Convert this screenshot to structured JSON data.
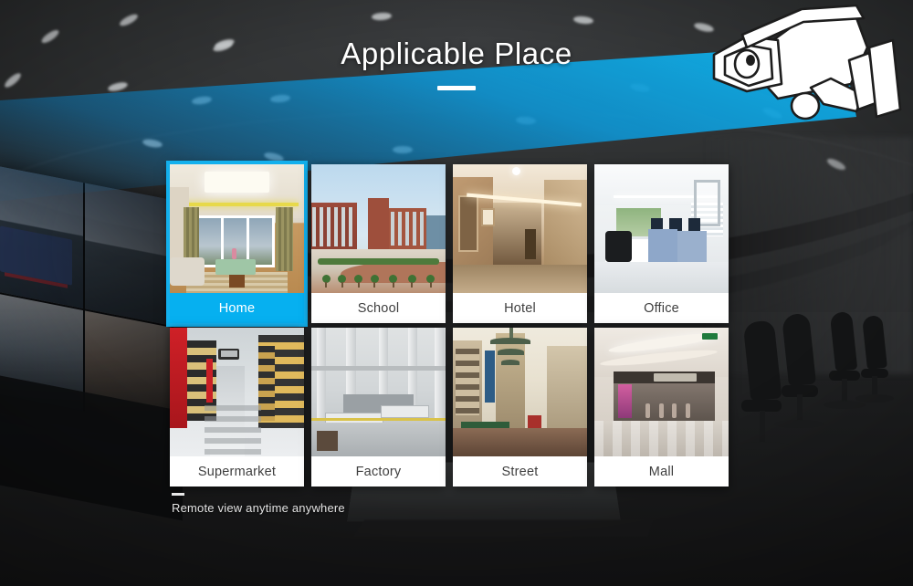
{
  "header": {
    "title": "Applicable Place"
  },
  "camera": {
    "icon": "cctv-camera-icon",
    "beam_color": "#0aa8e0"
  },
  "colors": {
    "accent": "#06b0f0",
    "card_bg": "#ffffff",
    "label_text": "#3f3f3f",
    "active_label_text": "#ffffff",
    "page_bg": "#222324"
  },
  "places": [
    {
      "id": "home",
      "label": "Home",
      "active": true,
      "scene": "living-room-thumbnail"
    },
    {
      "id": "school",
      "label": "School",
      "active": false,
      "scene": "campus-thumbnail"
    },
    {
      "id": "hotel",
      "label": "Hotel",
      "active": false,
      "scene": "hotel-corridor-thumbnail"
    },
    {
      "id": "office",
      "label": "Office",
      "active": false,
      "scene": "office-thumbnail"
    },
    {
      "id": "supermarket",
      "label": "Supermarket",
      "active": false,
      "scene": "supermarket-aisle-thumbnail"
    },
    {
      "id": "factory",
      "label": "Factory",
      "active": false,
      "scene": "factory-floor-thumbnail"
    },
    {
      "id": "street",
      "label": "Street",
      "active": false,
      "scene": "street-thumbnail"
    },
    {
      "id": "mall",
      "label": "Mall",
      "active": false,
      "scene": "mall-thumbnail"
    }
  ],
  "footer": {
    "tagline": "Remote view anytime  anywhere"
  }
}
